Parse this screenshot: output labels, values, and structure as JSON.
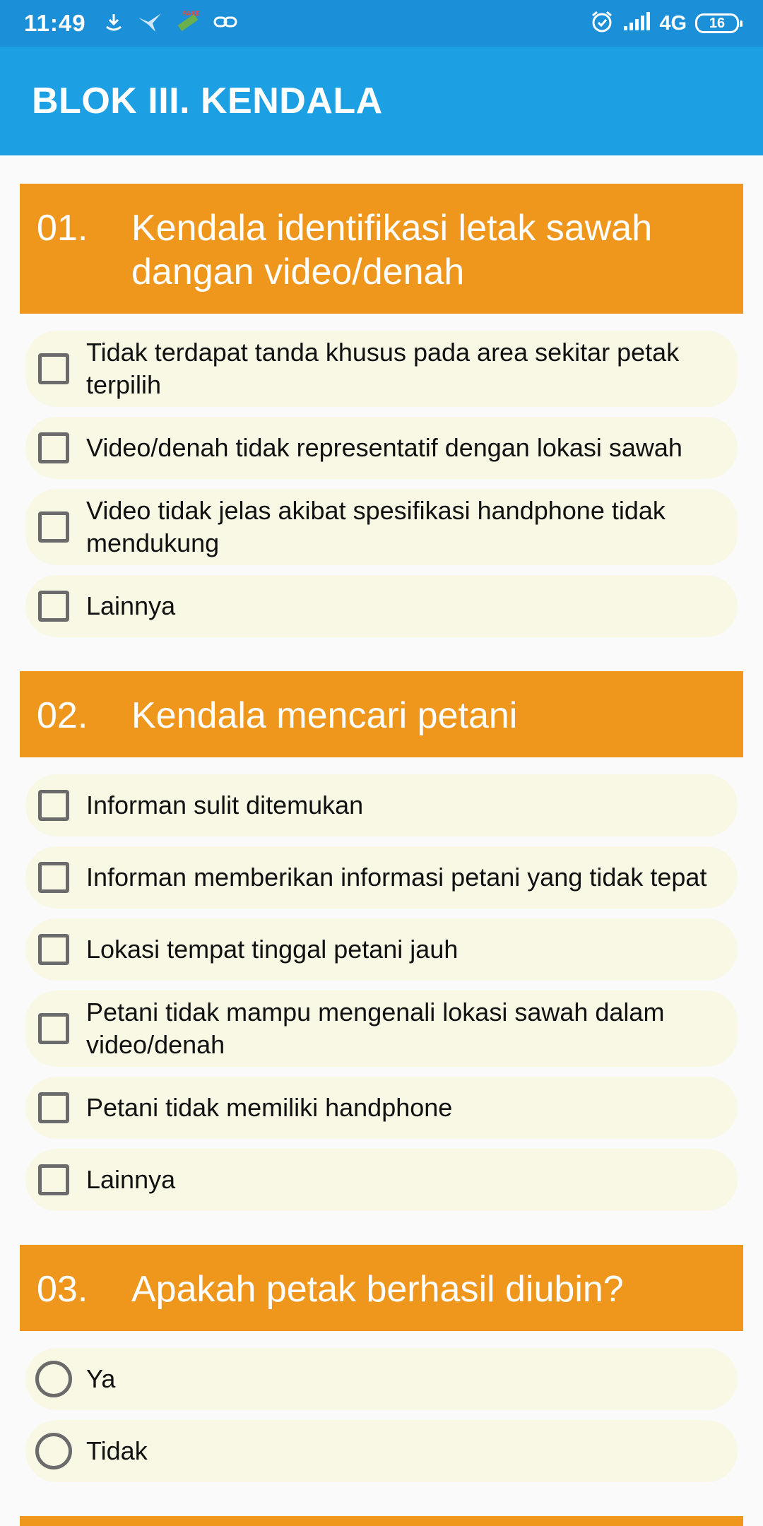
{
  "status_bar": {
    "time": "11:49",
    "network": "4G",
    "battery": "16",
    "icons_left": [
      "download-icon",
      "bird-icon",
      "fake-gps-icon",
      "link-icon"
    ],
    "icons_right": [
      "alarm-icon",
      "signal-icon"
    ]
  },
  "app_bar": {
    "title": "BLOK III. KENDALA"
  },
  "colors": {
    "status_bar": "#1b8fd8",
    "app_bar": "#1ca0e3",
    "question_header": "#ef971d",
    "option_bg": "#f8f8e4"
  },
  "questions": [
    {
      "number": "01.",
      "text": "Kendala identifikasi letak sawah dangan video/denah",
      "type": "checkbox",
      "options": [
        "Tidak terdapat tanda khusus pada area sekitar petak terpilih",
        "Video/denah tidak representatif dengan lokasi sawah",
        "Video tidak jelas akibat spesifikasi handphone tidak mendukung",
        "Lainnya"
      ]
    },
    {
      "number": "02.",
      "text": "Kendala mencari petani",
      "type": "checkbox",
      "options": [
        "Informan sulit ditemukan",
        "Informan memberikan informasi petani yang tidak tepat",
        "Lokasi tempat tinggal petani jauh",
        "Petani tidak mampu mengenali lokasi sawah dalam video/denah",
        "Petani tidak memiliki handphone",
        "Lainnya"
      ]
    },
    {
      "number": "03.",
      "text": "Apakah petak berhasil diubin?",
      "type": "radio",
      "options": [
        "Ya",
        "Tidak"
      ]
    }
  ]
}
